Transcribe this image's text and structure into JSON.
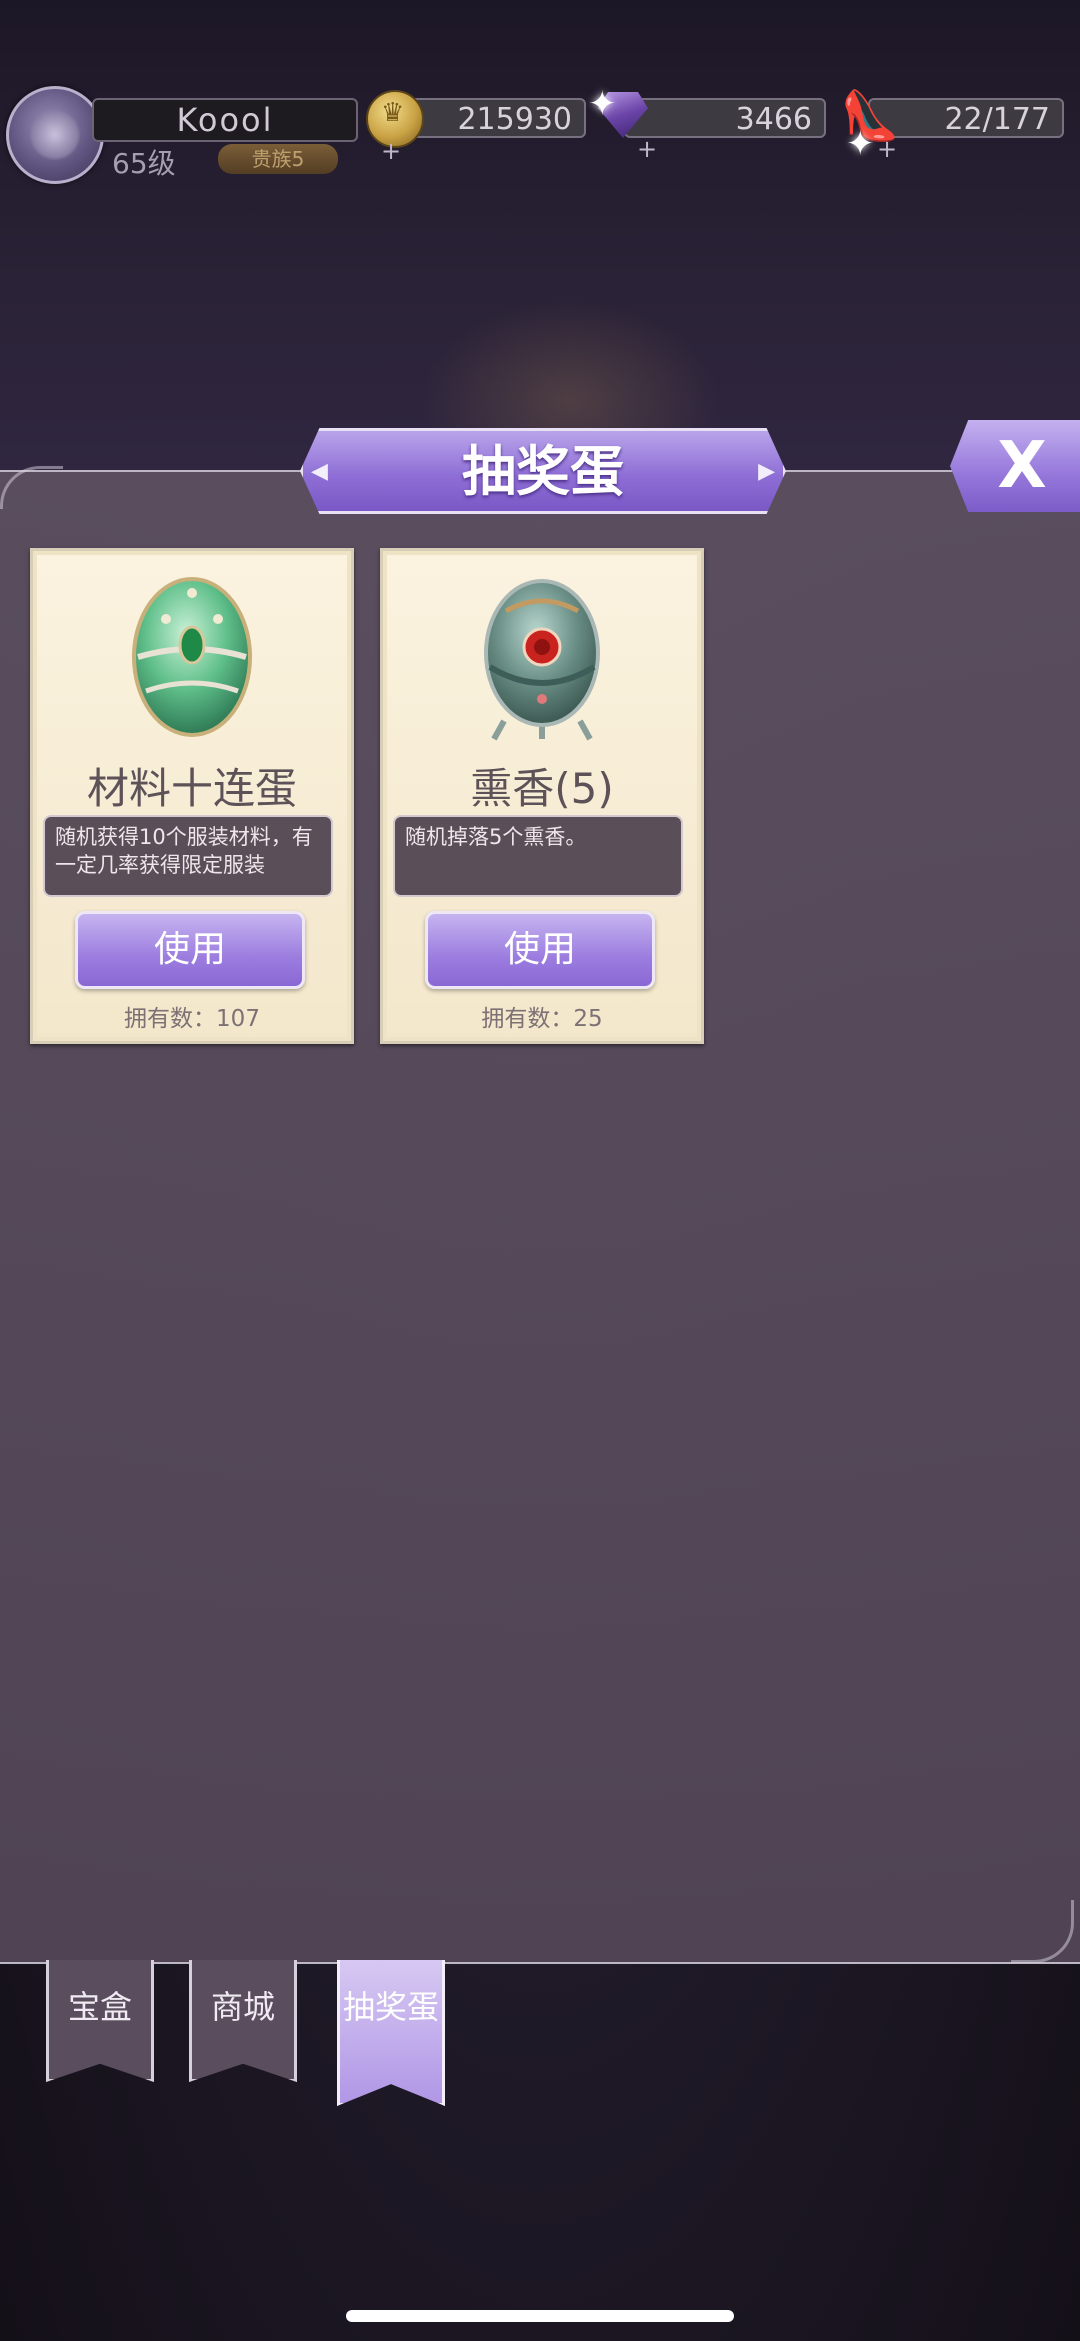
{
  "player": {
    "name": "Koool",
    "level": "65级",
    "rank": "贵族5"
  },
  "resources": {
    "gold": "215930",
    "gems": "3466",
    "stamina": "22/177"
  },
  "panel": {
    "title": "抽奖蛋",
    "close_label": "X"
  },
  "items": [
    {
      "name": "材料十连蛋",
      "description": "随机获得10个服装材料，有一定几率获得限定服装",
      "button": "使用",
      "owned": "拥有数：107",
      "egg_color": "#5fbf8a"
    },
    {
      "name": "熏香(5)",
      "description": "随机掉落5个熏香。",
      "button": "使用",
      "owned": "拥有数：25",
      "egg_color": "#6a8f86"
    }
  ],
  "tabs": [
    {
      "label": "宝盒"
    },
    {
      "label": "商城"
    },
    {
      "label": "抽奖蛋"
    }
  ],
  "colors": {
    "accent": "#9c7ddf",
    "panel": "#55495a",
    "card": "#f6ecd4"
  }
}
